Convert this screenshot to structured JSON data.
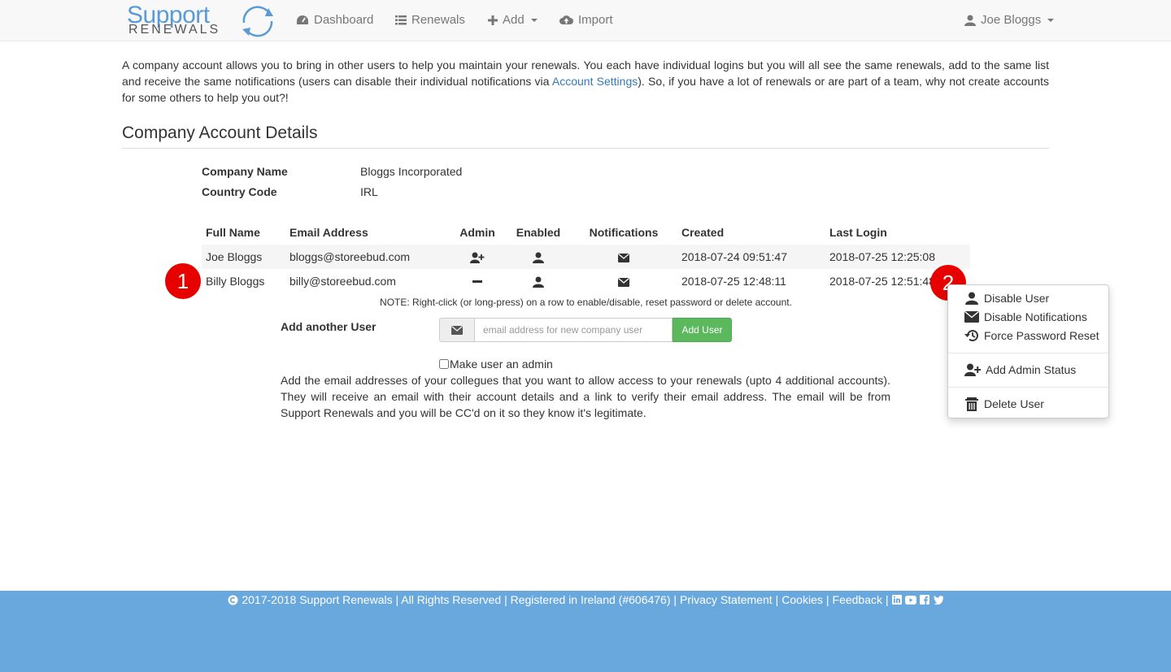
{
  "nav": {
    "logo_line1": "Support",
    "logo_line2": "RENEWALS",
    "dashboard": "Dashboard",
    "renewals": "Renewals",
    "add": "Add",
    "import": "Import",
    "user": "Joe Bloggs"
  },
  "intro": {
    "text_before": "A company account allows you to bring in other users to help you maintain your renewals. You each have individual logins but you will all see the same renewals, add to the same list and receive the same notifications (users can disable their individual notifications via ",
    "link": "Account Settings",
    "text_after": "). So, if you have a lot of renewals or are part of a team, why not create accounts for some others to help you out?!"
  },
  "section_title": "Company Account Details",
  "company": {
    "name_label": "Company Name",
    "name_value": "Bloggs Incorporated",
    "country_label": "Country Code",
    "country_value": "IRL"
  },
  "table": {
    "headers": [
      "Full Name",
      "Email Address",
      "Admin",
      "Enabled",
      "Notifications",
      "Created",
      "Last Login"
    ],
    "rows": [
      {
        "name": "Joe Bloggs",
        "email": "bloggs@storeebud.com",
        "admin": "user-plus-icon",
        "enabled": "user-icon",
        "notifications": "envelope-icon",
        "created": "2018-07-24 09:51:47",
        "last_login": "2018-07-25 12:25:08"
      },
      {
        "name": "Billy Bloggs",
        "email": "billy@storeebud.com",
        "admin": "minus-icon",
        "enabled": "user-icon",
        "notifications": "envelope-icon",
        "created": "2018-07-25 12:48:11",
        "last_login": "2018-07-25 12:51:48"
      }
    ]
  },
  "note": "NOTE: Right-click (or long-press) on a row to enable/disable, reset password or delete account.",
  "add_user": {
    "label": "Add another User",
    "placeholder": "email address for new company user",
    "button": "Add User",
    "admin_checkbox": "Make user an admin",
    "help": "Add the email addresses of your collegues that you want to allow access to your renewals (upto 4 additional accounts). They will receive an email with their account details and a link to verify their email address. The email will be from Support Renewals and you will be CC'd on it so they know it's legitimate."
  },
  "badges": [
    "1",
    "2"
  ],
  "context_menu": {
    "disable_user": "Disable User",
    "disable_notifications": "Disable Notifications",
    "force_password_reset": "Force Password Reset",
    "add_admin": "Add Admin Status",
    "delete_user": "Delete User"
  },
  "footer": {
    "copyright": "2017-2018 Support Renewals | All Rights Reserved | Registered in Ireland (#606476) |",
    "privacy": "Privacy Statement",
    "cookies": "Cookies",
    "feedback": "Feedback"
  },
  "colors": {
    "brand": "#5b9bd5",
    "footer": "#69a8dc",
    "success": "#5cb85c",
    "badge": "#e60000"
  }
}
